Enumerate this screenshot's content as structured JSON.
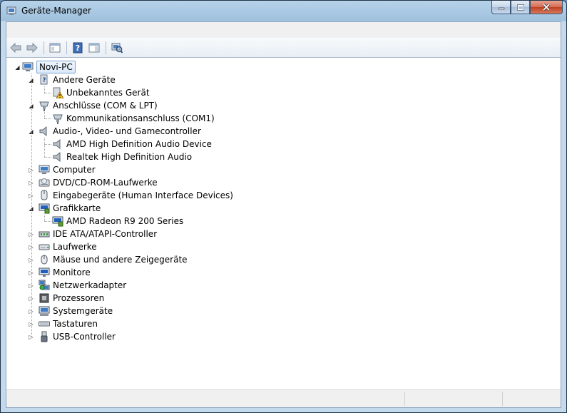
{
  "window": {
    "title": "Geräte-Manager"
  },
  "toolbar": {
    "icons": [
      "back-arrow-icon",
      "forward-arrow-icon",
      "show-hide-console-tree-icon",
      "help-icon",
      "action-pane-icon",
      "scan-hardware-icon"
    ]
  },
  "tree": {
    "root": "Novi-PC",
    "categories": [
      {
        "label": "Andere Geräte",
        "expanded": true,
        "children": [
          "Unbekanntes Gerät"
        ]
      },
      {
        "label": "Anschlüsse (COM & LPT)",
        "expanded": true,
        "children": [
          "Kommunikationsanschluss (COM1)"
        ]
      },
      {
        "label": "Audio-, Video- und Gamecontroller",
        "expanded": true,
        "children": [
          "AMD High Definition Audio Device",
          "Realtek High Definition Audio"
        ]
      },
      {
        "label": "Computer",
        "expanded": false
      },
      {
        "label": "DVD/CD-ROM-Laufwerke",
        "expanded": false
      },
      {
        "label": "Eingabegeräte (Human Interface Devices)",
        "expanded": false
      },
      {
        "label": "Grafikkarte",
        "expanded": true,
        "children": [
          "AMD Radeon R9 200 Series"
        ]
      },
      {
        "label": "IDE ATA/ATAPI-Controller",
        "expanded": false
      },
      {
        "label": "Laufwerke",
        "expanded": false
      },
      {
        "label": "Mäuse und andere Zeigegeräte",
        "expanded": false
      },
      {
        "label": "Monitore",
        "expanded": false
      },
      {
        "label": "Netzwerkadapter",
        "expanded": false
      },
      {
        "label": "Prozessoren",
        "expanded": false
      },
      {
        "label": "Systemgeräte",
        "expanded": false
      },
      {
        "label": "Tastaturen",
        "expanded": false
      },
      {
        "label": "USB-Controller",
        "expanded": false
      }
    ]
  }
}
